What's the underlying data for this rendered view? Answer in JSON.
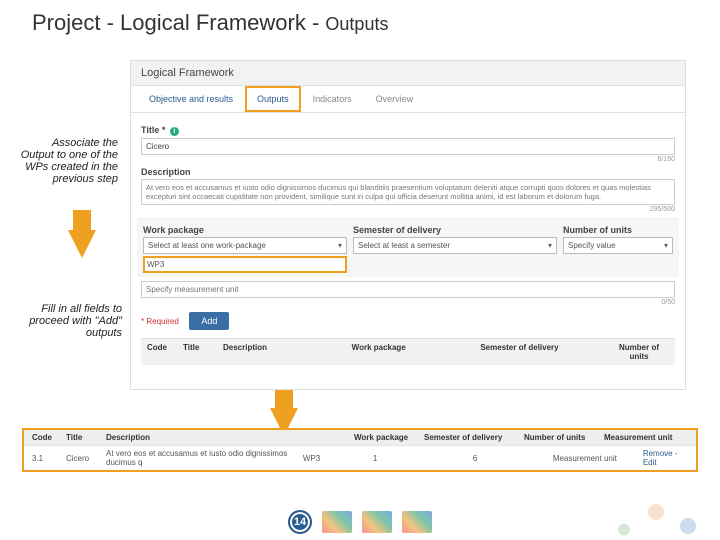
{
  "slide": {
    "title_main": "Project - Logical Framework - ",
    "title_small": "Outputs",
    "page_number": "14"
  },
  "annotations": {
    "a1": "Associate the Output to one of the WPs created in the previous step",
    "a2": "Fill in all fields to proceed with \"Add\" outputs"
  },
  "panel": {
    "header": "Logical Framework",
    "tabs": [
      "Objective and results",
      "Outputs",
      "Indicators",
      "Overview"
    ],
    "active_tab_index": 1,
    "title_label": "Title",
    "title_value": "Cicero",
    "title_counter": "6/150",
    "desc_label": "Description",
    "desc_value": "At vero eos et accusamus et iusto odio dignissimos ducimus qui blanditiis praesentium voluptatum deleniti atque corrupti quos dolores et quas molestias excepturi sint occaecati cupiditate non provident, similique sunt in culpa qui officia deserunt mollitia animi, id est laborum et dolorum fuga.",
    "desc_counter": "295/500",
    "wp_label": "Work package",
    "wp_placeholder": "Select at least one work-package",
    "wp_selected": "WP3",
    "sem_label": "Semester of delivery",
    "sem_placeholder": "Select at least a semester",
    "units_label": "Number of units",
    "units_placeholder": "Specify value",
    "measure_placeholder": "Specify measurement unit",
    "measure_counter": "0/50",
    "required": "* Required",
    "add_button": "Add",
    "table_cols": [
      "Code",
      "Title",
      "Description",
      "Work package",
      "Semester of delivery",
      "Number of units"
    ]
  },
  "result_table": {
    "cols": [
      "Code",
      "Title",
      "Description",
      "Work package",
      "Semester of delivery",
      "Number of units",
      "Measurement unit"
    ],
    "row": {
      "code": "3.1",
      "title": "Cicero",
      "desc": "At vero eos et accusamus et iusto odio dignissimos ducimus q",
      "wp": "WP3",
      "sem": "1",
      "units": "6",
      "measure": "Measurement unit",
      "actions": "Remove - Edit"
    }
  }
}
